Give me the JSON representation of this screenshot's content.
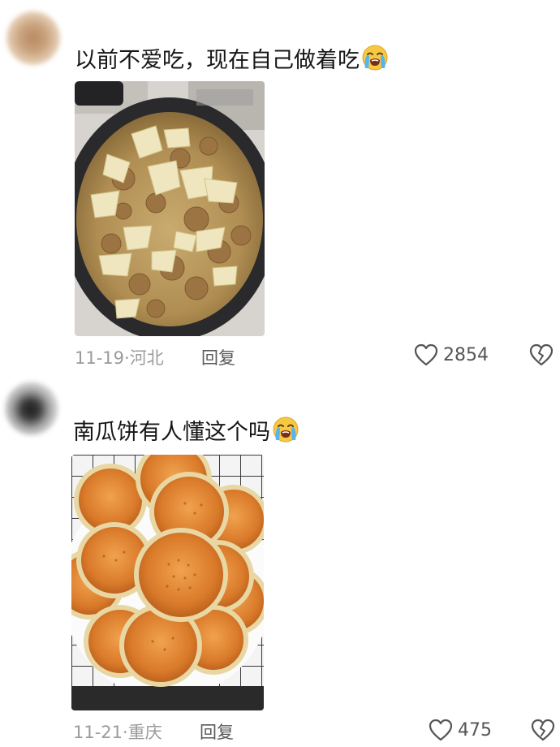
{
  "comments": [
    {
      "text": "以前不爱吃，现在自己做着吃",
      "emoji": "loudly-crying-face-emoji",
      "photo": "braised-meatballs-cabbage-wok-photo",
      "date": "11-19",
      "location": "河北",
      "reply_label": "回复",
      "like_count": "2854"
    },
    {
      "text": "南瓜饼有人懂这个吗",
      "emoji": "loudly-crying-face-emoji",
      "photo": "pumpkin-sesame-pancakes-plate-photo",
      "date": "11-21",
      "location": "重庆",
      "reply_label": "回复",
      "like_count": "475"
    }
  ],
  "meta_separator": "·",
  "icons": {
    "like": "heart-outline-icon",
    "dislike": "broken-heart-outline-icon"
  },
  "colors": {
    "meta_gray": "#9b9b9b",
    "text": "#161616",
    "icon_gray": "#555555"
  }
}
